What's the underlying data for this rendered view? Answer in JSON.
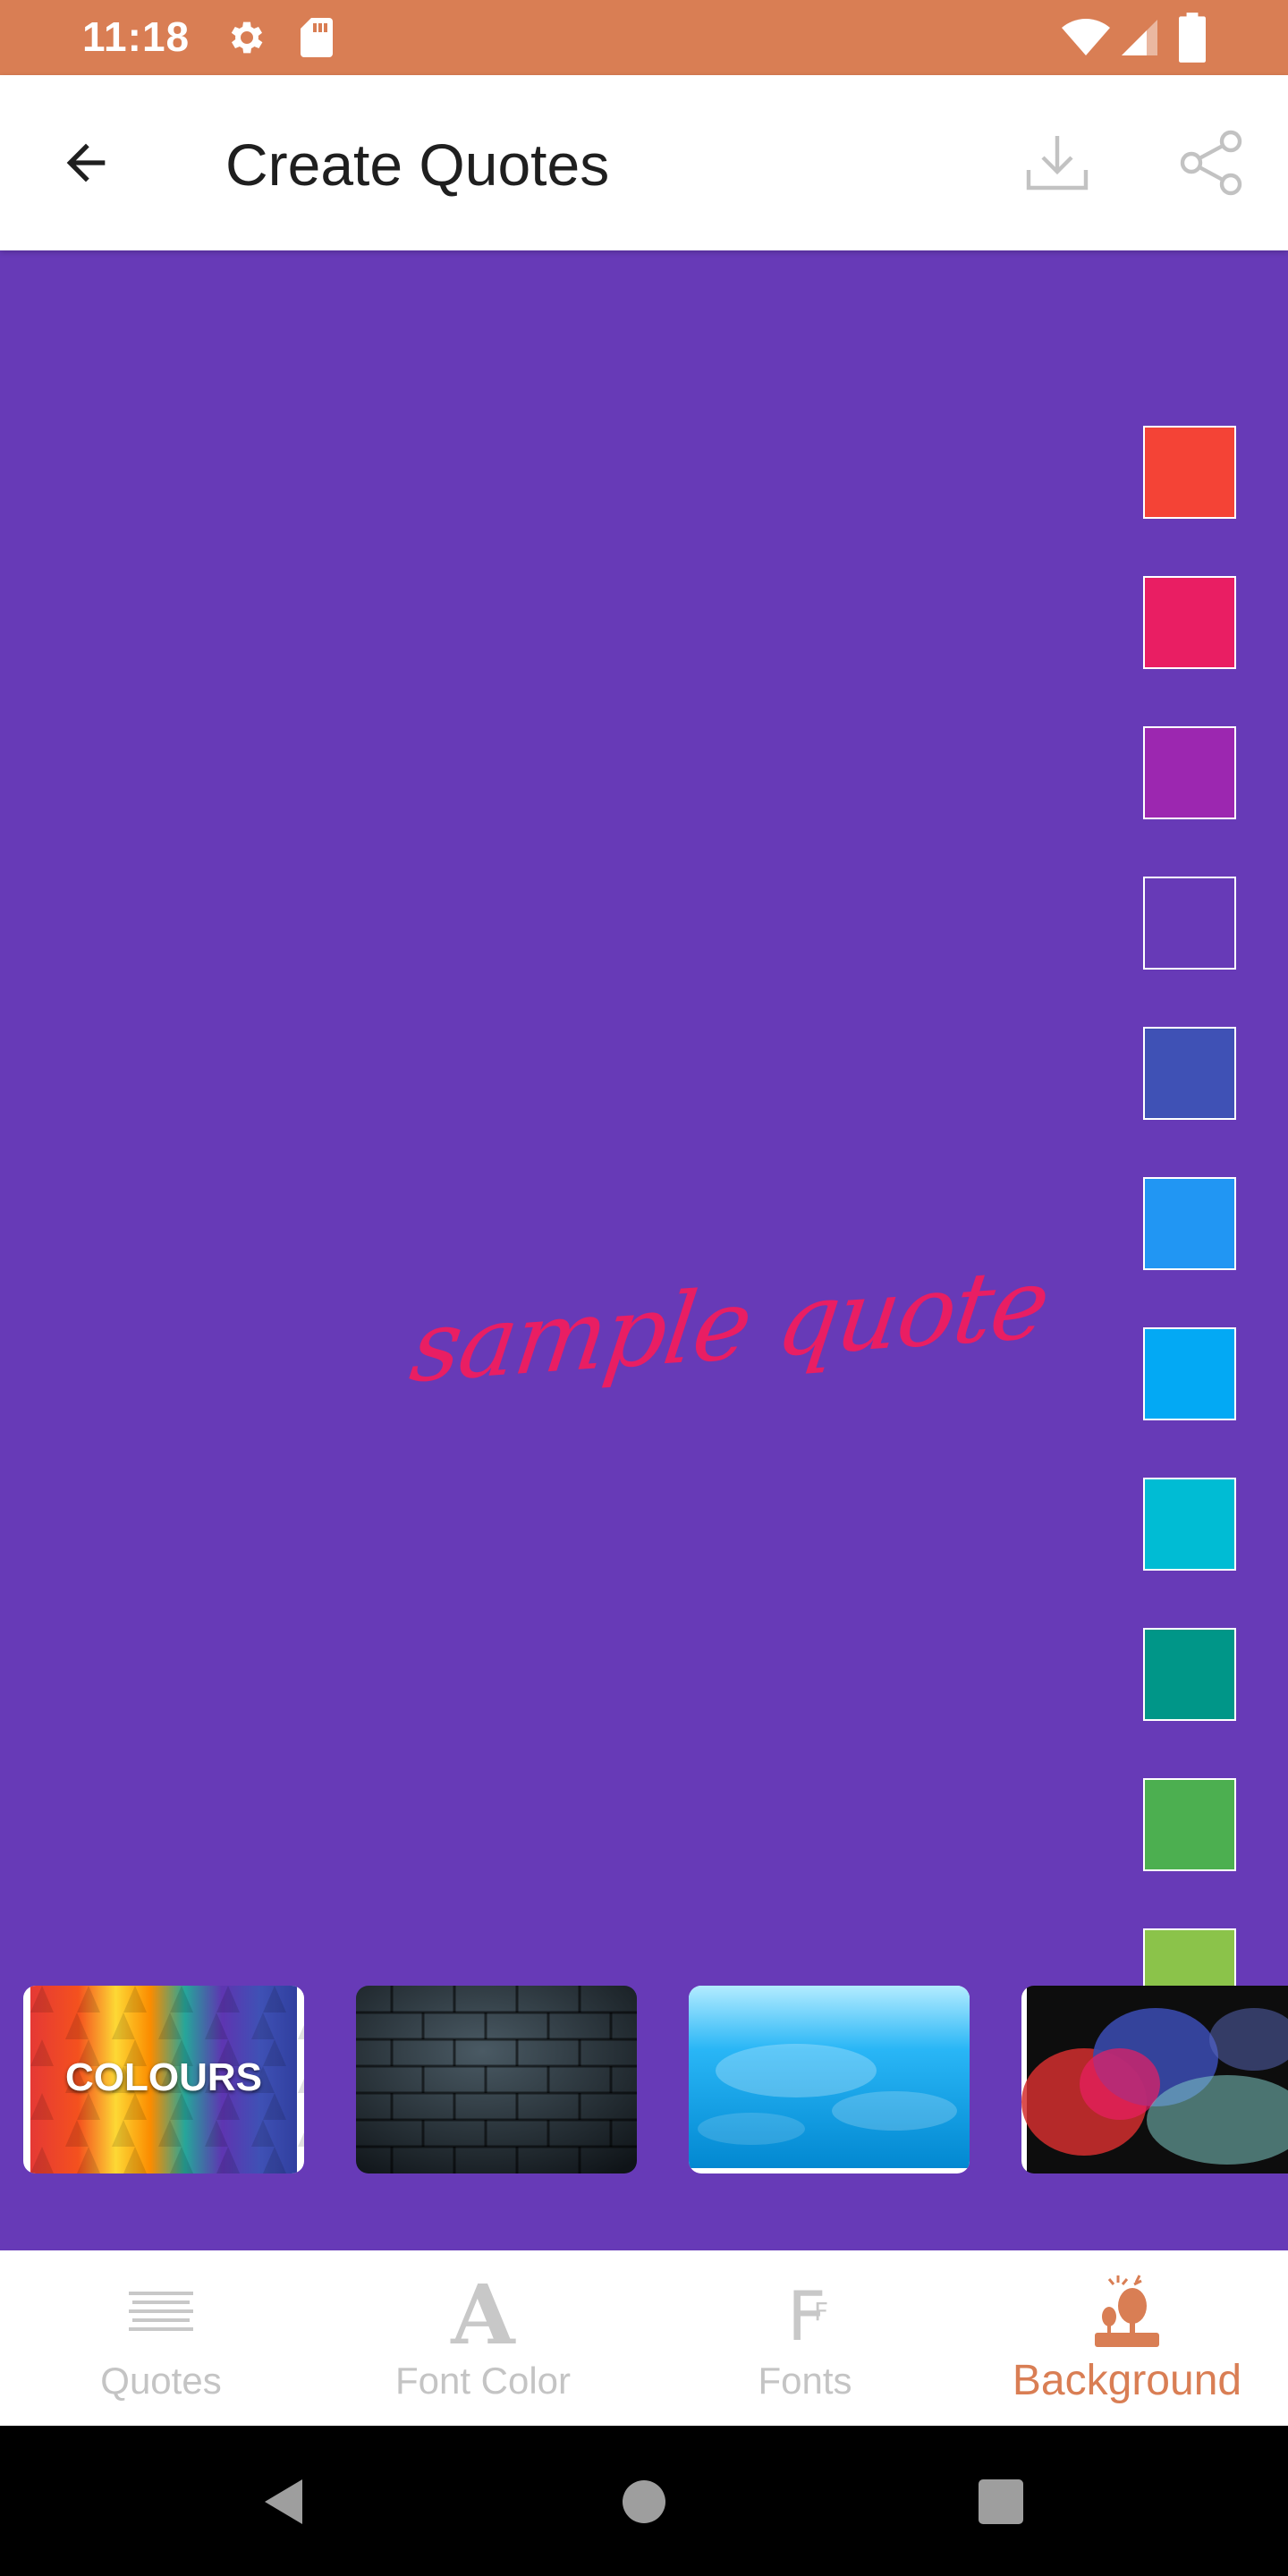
{
  "status_bar": {
    "time": "11:18",
    "icons": [
      "gear-icon",
      "sd-card-icon",
      "wifi-icon",
      "signal-icon",
      "battery-icon"
    ]
  },
  "app_bar": {
    "title": "Create Quotes",
    "icons": [
      "back-arrow-icon",
      "download-icon",
      "share-icon"
    ]
  },
  "canvas": {
    "background_color": "#673ab7",
    "quote_text": "sample quote",
    "quote_color": "#e91e63",
    "swatches": [
      "#f44336",
      "#e91e63",
      "#9c27b0",
      "#673ab7",
      "#3f51b5",
      "#2196f3",
      "#03a9f4",
      "#00bcd4",
      "#009688",
      "#4caf50",
      "#8bc34a"
    ]
  },
  "background_thumbnails": [
    {
      "label": "COLOURS",
      "kind": "colours"
    },
    {
      "label": "",
      "kind": "dark-bricks"
    },
    {
      "label": "",
      "kind": "blue-water"
    },
    {
      "label": "",
      "kind": "color-smoke"
    }
  ],
  "bottom_nav": {
    "items": [
      {
        "label": "Quotes",
        "icon": "quotes-lines-icon",
        "active": false
      },
      {
        "label": "Font Color",
        "icon": "font-color-icon",
        "active": false
      },
      {
        "label": "Fonts",
        "icon": "fonts-icon",
        "active": false
      },
      {
        "label": "Background",
        "icon": "background-icon",
        "active": true
      }
    ],
    "active_color": "#d97e54"
  },
  "system_nav": [
    "back-triangle-icon",
    "home-circle-icon",
    "recents-square-icon"
  ]
}
